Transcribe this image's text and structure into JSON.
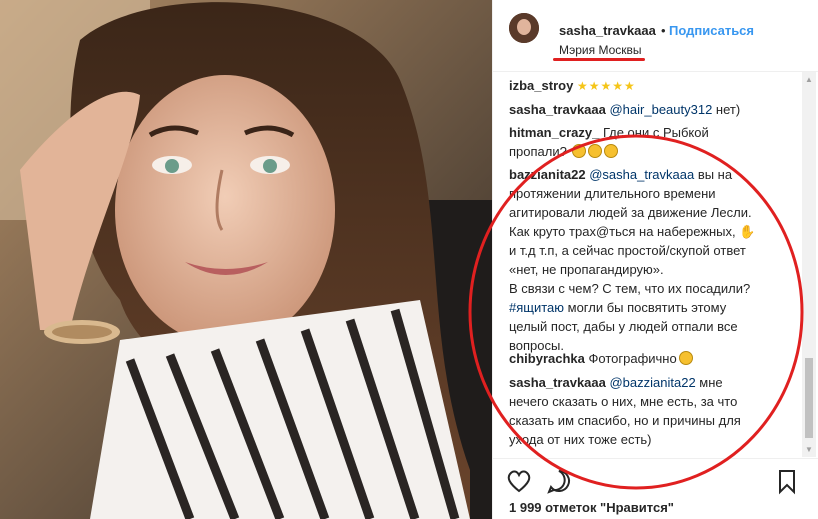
{
  "header": {
    "username": "sasha_travkaaa",
    "dot": "•",
    "follow_label": "Подписаться",
    "location": "Мэрия Москвы"
  },
  "comments": [
    {
      "user": "izba_stroy",
      "parts": [
        {
          "t": "stars",
          "v": "★★★★★"
        }
      ]
    },
    {
      "user": "sasha_travkaaa",
      "parts": [
        {
          "t": "mention",
          "v": "@hair_beauty312"
        },
        {
          "t": "text",
          "v": " нет)"
        }
      ]
    },
    {
      "user": "hitman_crazy_",
      "parts": [
        {
          "t": "text",
          "v": "Где они с Рыбкой пропали?"
        }
      ]
    },
    {
      "user": "bazzianita22",
      "parts": [
        {
          "t": "mention",
          "v": "@sasha_travkaaa"
        },
        {
          "t": "text",
          "v": " вы на протяжении длительного времени агитировали людей за движение Лесли. Как круто трах@ться на набережных,"
        },
        {
          "t": "text2",
          "v": " и т.д т.п, а сейчас простой/скупой ответ «нет, не пропагандирую»."
        },
        {
          "t": "text3",
          "v": "В связи с чем? С тем, что их посадили?"
        },
        {
          "t": "tag",
          "v": "#ящитаю"
        },
        {
          "t": "text4",
          "v": " могли бы посвятить этому целый пост, дабы у людей отпали все вопросы."
        }
      ]
    },
    {
      "user": "chibyrachka",
      "parts": [
        {
          "t": "text",
          "v": "Фотографично"
        }
      ]
    },
    {
      "user": "sasha_travkaaa",
      "parts": [
        {
          "t": "mention",
          "v": "@bazzianita22"
        },
        {
          "t": "text",
          "v": " мне нечего сказать о них, мне есть, за что сказать им спасибо, но и причины для ухода от них тоже есть)"
        }
      ]
    }
  ],
  "likes_text": "1 999 отметок \"Нравится\"",
  "icons": [
    "heart-icon",
    "comment-icon",
    "share-icon",
    "bookmark-icon"
  ],
  "colors": {
    "link": "#3897f0",
    "mention": "#003569",
    "annotation": "#e02020"
  }
}
